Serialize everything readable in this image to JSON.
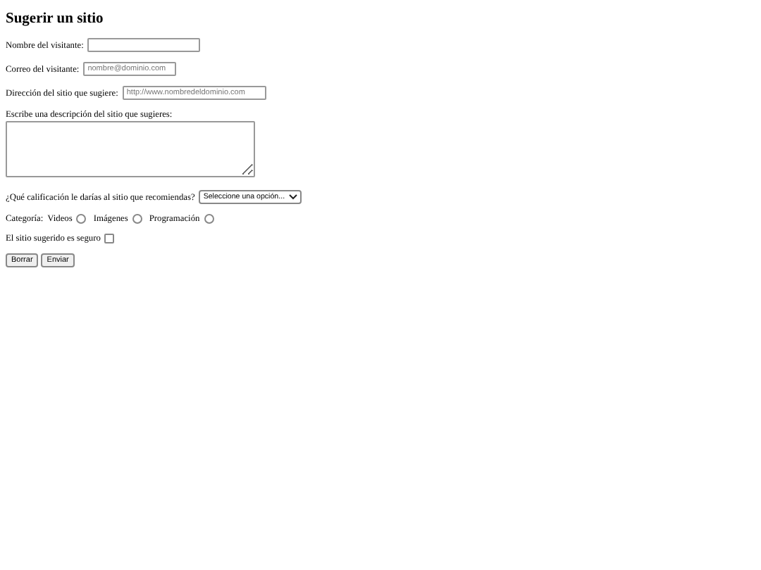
{
  "title": "Sugerir un sitio",
  "fields": [
    {
      "label": "Nombre del visitante:"
    },
    {
      "label": "Correo del visitante:",
      "placeholder": "nombre@dominio.com"
    },
    {
      "label": "Dirección del sitio que sugiere:",
      "placeholder": "http://www.nombredeldominio.com"
    }
  ],
  "description": {
    "label": "Escribe una descripción del sitio que sugieres:"
  },
  "rating": {
    "label": "¿Qué calificación le darías al sitio que recomiendas?",
    "value": "Seleccione una opción..."
  },
  "category": {
    "label": "Categoría:",
    "options": [
      {
        "label": "Videos",
        "selected": false
      },
      {
        "label": "Imágenes",
        "selected": false
      },
      {
        "label": "Programación",
        "selected": false
      }
    ]
  },
  "safe": {
    "label": "El sitio sugerido es seguro",
    "checked": false
  },
  "buttons": [
    "Borrar",
    "Enviar"
  ]
}
